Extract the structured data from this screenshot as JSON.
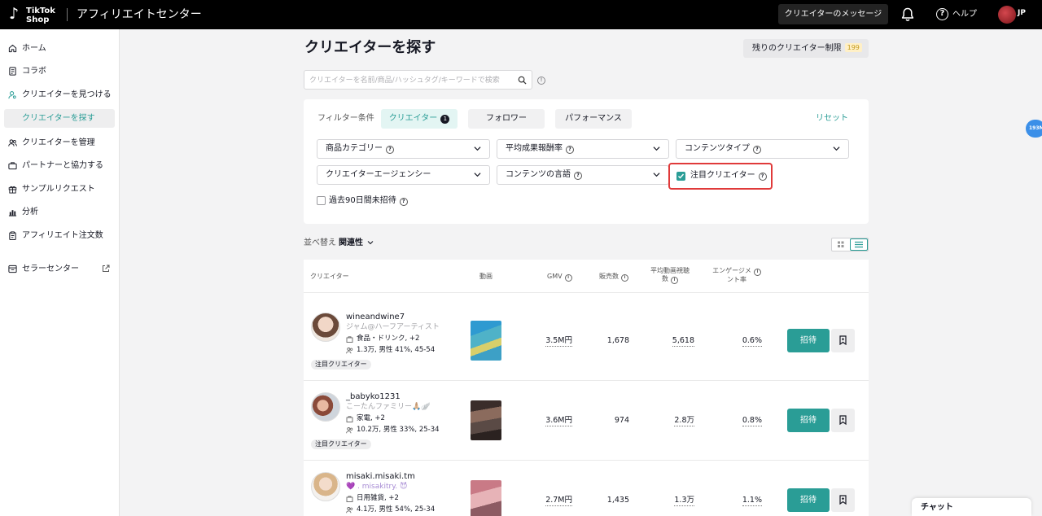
{
  "header": {
    "logo_line1": "TikTok",
    "logo_line2": "Shop",
    "title": "アフィリエイトセンター",
    "messages_button": "クリエイターのメッセージ",
    "help_label": "ヘルプ",
    "region": "JP"
  },
  "sidebar": {
    "items": [
      {
        "label": "ホーム",
        "icon": "home-icon"
      },
      {
        "label": "コラボ",
        "icon": "document-icon"
      },
      {
        "label": "クリエイターを見つける",
        "icon": "person-search-icon"
      },
      {
        "label": "クリエイターを探す",
        "icon": "",
        "active": true
      },
      {
        "label": "クリエイターを管理",
        "icon": "people-icon"
      },
      {
        "label": "パートナーと協力する",
        "icon": "briefcase-icon"
      },
      {
        "label": "サンプルリクエスト",
        "icon": "gift-icon"
      },
      {
        "label": "分析",
        "icon": "chart-icon"
      },
      {
        "label": "アフィリエイト注文数",
        "icon": "clipboard-icon"
      },
      {
        "label": "セラーセンター",
        "icon": "store-icon"
      }
    ]
  },
  "page": {
    "title": "クリエイターを探す",
    "limit_label": "残りのクリエイター制限",
    "limit_count": "199"
  },
  "search": {
    "placeholder": "クリエイターを名前/商品/ハッシュタグ/キーワードで検索",
    "value": ""
  },
  "filters": {
    "label": "フィルター条件",
    "tabs": [
      {
        "label": "クリエイター",
        "count": "1",
        "active": true
      },
      {
        "label": "フォロワー"
      },
      {
        "label": "パフォーマンス"
      }
    ],
    "reset": "リセット",
    "dropdowns": [
      "商品カテゴリー",
      "平均成果報酬率",
      "コンテンツタイプ",
      "クリエイターエージェンシー",
      "コンテンツの言語"
    ],
    "featured_checkbox": {
      "label": "注目クリエイター",
      "checked": true
    },
    "past_checkbox": {
      "label": "過去90日間未招待",
      "checked": false
    }
  },
  "sort": {
    "label": "並べ替え",
    "value": "関連性"
  },
  "table": {
    "headers": {
      "creator": "クリエイター",
      "video": "動画",
      "gmv": "GMV",
      "sales": "販売数",
      "avg_views_1": "平均動画視聴",
      "avg_views_2": "数",
      "engagement_1": "エンゲージメ",
      "engagement_2": "ント率"
    },
    "rows": [
      {
        "name": "wineandwine7",
        "sub": "ジャム@ハーフアーティスト",
        "category": "食品・ドリンク, +2",
        "demographics": "1.3万, 男性 41%, 45-54",
        "tag": "注目クリエイター",
        "gmv": "3.5M円",
        "sales": "1,678",
        "avg_views": "5,618",
        "engagement": "0.6%",
        "invite": "招待"
      },
      {
        "name": "_babyko1231",
        "sub": "こーたんファミリー🙏🏼🪽",
        "category": "家電, +2",
        "demographics": "10.2万, 男性 33%, 25-34",
        "tag": "注目クリエイター",
        "gmv": "3.6M円",
        "sales": "974",
        "avg_views": "2.8万",
        "engagement": "0.8%",
        "invite": "招待"
      },
      {
        "name": "misaki.misaki.tm",
        "sub": "💜 . misakitry. 😈",
        "category": "日用雑貨, +2",
        "demographics": "4.1万, 男性 54%, 25-34",
        "tag": "",
        "gmv": "2.7M円",
        "sales": "1,435",
        "avg_views": "1.3万",
        "engagement": "1.1%",
        "invite": "招待"
      }
    ]
  },
  "floating_badge": "193M",
  "chat_label": "チャット",
  "colors": {
    "accent": "#2a9d96",
    "highlight_border": "#e03a3a",
    "topbar": "#000000"
  }
}
